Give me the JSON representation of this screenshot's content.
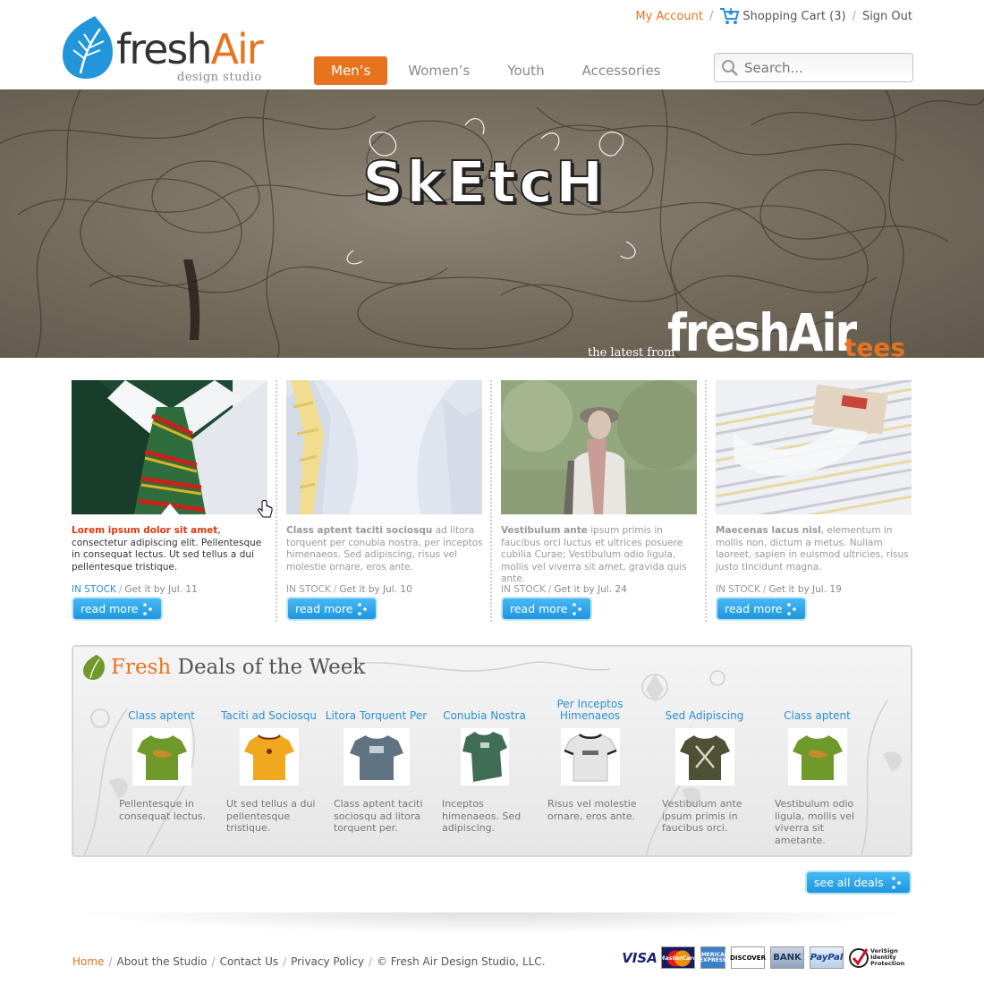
{
  "brand": {
    "name_part1": "fresh",
    "name_part2": "Air",
    "subtitle": "design studio"
  },
  "util": {
    "my_account": "My Account",
    "cart": "Shopping Cart (3)",
    "sign_out": "Sign Out"
  },
  "nav": {
    "items": [
      "Men’s",
      "Women’s",
      "Youth",
      "Accessories"
    ],
    "active": "Men’s"
  },
  "search": {
    "placeholder": "Search..."
  },
  "hero": {
    "title": "SkEtcH",
    "tagline_small": "the latest from",
    "tagline_big": "freshAir",
    "tagline_tees": "tees"
  },
  "products": [
    {
      "lead": "Lorem ipsum dolor sit amet",
      "text": ", consectetur adipiscing elit. Pellentesque in consequat lectus. Ut sed tellus a dui pellentesque tristique.",
      "stock": "IN STOCK",
      "ship": "Get it by Jul. 11",
      "button": "read more"
    },
    {
      "lead": "Class aptent taciti sociosqu",
      "text": " ad litora torquent per conubia nostra, per inceptos himenaeos. Sed adipiscing, risus vel molestie ornare, eros ante.",
      "stock": "IN STOCK",
      "ship": "Get it by Jul. 10",
      "button": "read more"
    },
    {
      "lead": "Vestibulum ante",
      "text": " ipsum primis in faucibus orci luctus et ultrices posuere cubilia Curae; Vestibulum odio ligula, mollis vel viverra sit amet, gravida quis ante.",
      "stock": "IN STOCK",
      "ship": "Get it by Jul. 24",
      "button": "read more"
    },
    {
      "lead": "Maecenas lacus nisl",
      "text": ", elementum in mollis non, dictum a metus. Nullam laoreet, sapien in euismod ultricies, risus justo tincidunt magna.",
      "stock": "IN STOCK",
      "ship": "Get it by Jul. 19",
      "button": "read more"
    }
  ],
  "deals": {
    "title_fresh": "Fresh",
    "title_rest": " Deals of the Week",
    "items": [
      {
        "name": "Class aptent",
        "text": "Pellentesque in consequat lectus.",
        "shirt_color": "#6f9a2b"
      },
      {
        "name": "Taciti ad Sociosqu",
        "text": "Ut sed tellus a dui pellentesque tristique.",
        "shirt_color": "#f0a81e"
      },
      {
        "name": "Litora Torquent Per",
        "text": "Class aptent taciti sociosqu ad litora torquent per.",
        "shirt_color": "#5f7382"
      },
      {
        "name": "Conubia Nostra",
        "text": "Inceptos himenaeos. Sed adipiscing.",
        "shirt_color": "#3f6e55"
      },
      {
        "name": "Per Inceptos Himenaeos",
        "text": "Risus vel molestie ornare, eros ante.",
        "shirt_color": "#e4e4e4"
      },
      {
        "name": "Sed Adipiscing",
        "text": "Vestibulum ante ipsum primis in faucibus orci.",
        "shirt_color": "#4e5134"
      },
      {
        "name": "Class aptent",
        "text": "Vestibulum odio ligula, mollis vel viverra sit ametante.",
        "shirt_color": "#6f9a2b"
      }
    ],
    "see_all": "see all deals"
  },
  "footer": {
    "links": [
      "Home",
      "About the Studio",
      "Contact Us",
      "Privacy Policy"
    ],
    "copyright": "© Fresh Air Design Studio, LLC."
  },
  "payments": {
    "visa": "VISA",
    "mastercard": "MasterCard",
    "amex": "AMERICAN EXPRESS",
    "discover": "DISCOVER",
    "bank": "BANK",
    "paypal": "PayPal",
    "verisign": "VeriSign Identity Protection"
  },
  "colors": {
    "accent": "#e8731e",
    "link_blue": "#2a8fd0",
    "button_blue": "#1e96e0"
  }
}
